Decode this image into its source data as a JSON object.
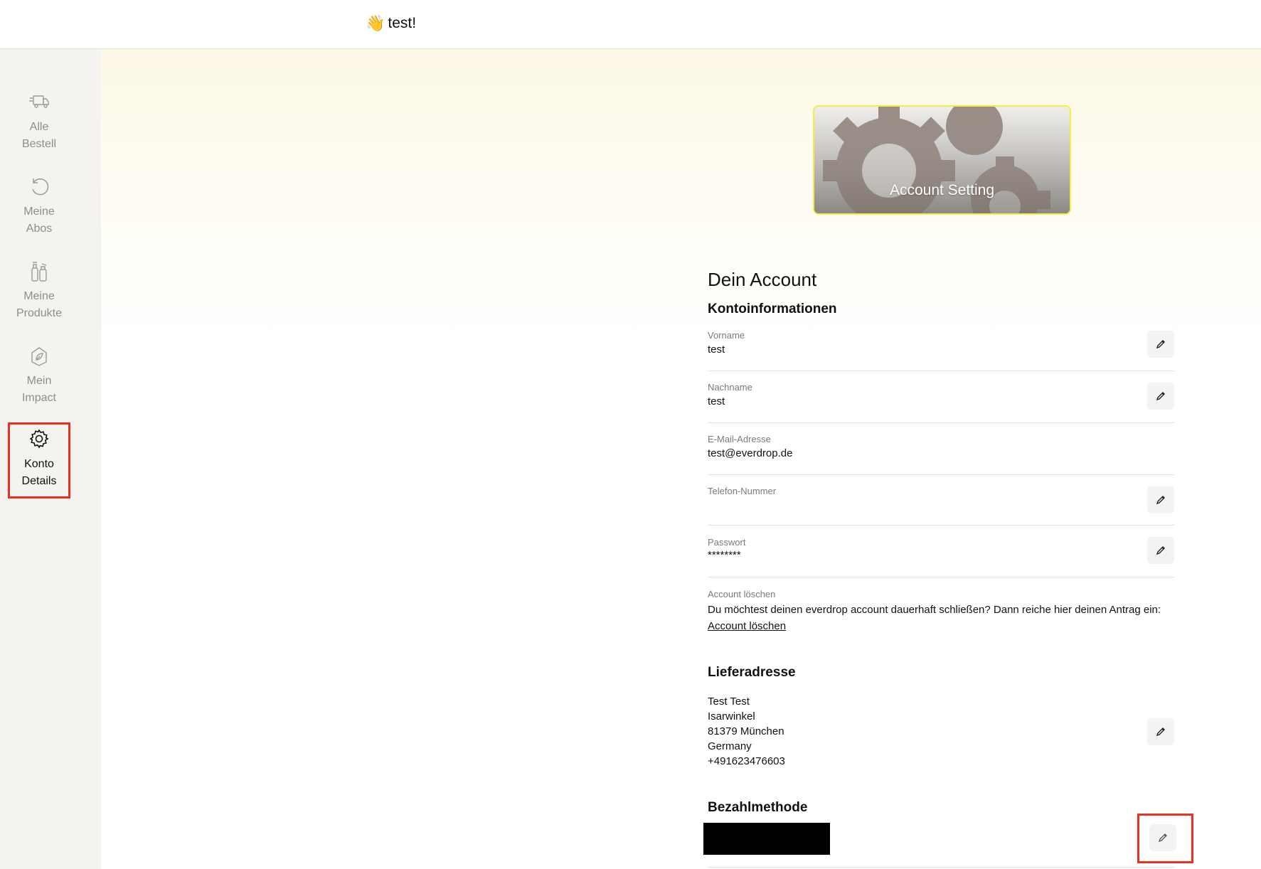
{
  "header": {
    "greeting_emoji": "👋",
    "greeting_text": "test!"
  },
  "sidebar": {
    "items": [
      {
        "label_line1": "Alle",
        "label_line2": "Bestell",
        "icon": "truck-icon",
        "active": false
      },
      {
        "label_line1": "Meine",
        "label_line2": "Abos",
        "icon": "refresh-icon",
        "active": false
      },
      {
        "label_line1": "Meine",
        "label_line2": "Produkte",
        "icon": "bottles-icon",
        "active": false
      },
      {
        "label_line1": "Mein",
        "label_line2": "Impact",
        "icon": "leaf-icon",
        "active": false
      },
      {
        "label_line1": "Konto",
        "label_line2": "Details",
        "icon": "gear-icon",
        "active": true
      }
    ]
  },
  "banner": {
    "title": "Account Setting"
  },
  "account": {
    "title": "Dein Account",
    "section_title": "Kontoinformationen",
    "fields": {
      "vorname": {
        "label": "Vorname",
        "value": "test"
      },
      "nachname": {
        "label": "Nachname",
        "value": "test"
      },
      "email": {
        "label": "E-Mail-Adresse",
        "value": "test@everdrop.de"
      },
      "telefon": {
        "label": "Telefon-Nummer",
        "value": ""
      },
      "passwort": {
        "label": "Passwort",
        "value": "********"
      }
    },
    "delete": {
      "label": "Account löschen",
      "text": "Du möchtest deinen everdrop account dauerhaft schließen? Dann reiche hier deinen Antrag ein:",
      "link": "Account löschen"
    }
  },
  "shipping": {
    "title": "Lieferadresse",
    "lines": [
      "Test Test",
      "Isarwinkel",
      "81379 München",
      "Germany",
      "+491623476603"
    ]
  },
  "payment": {
    "title": "Bezahlmethode"
  }
}
